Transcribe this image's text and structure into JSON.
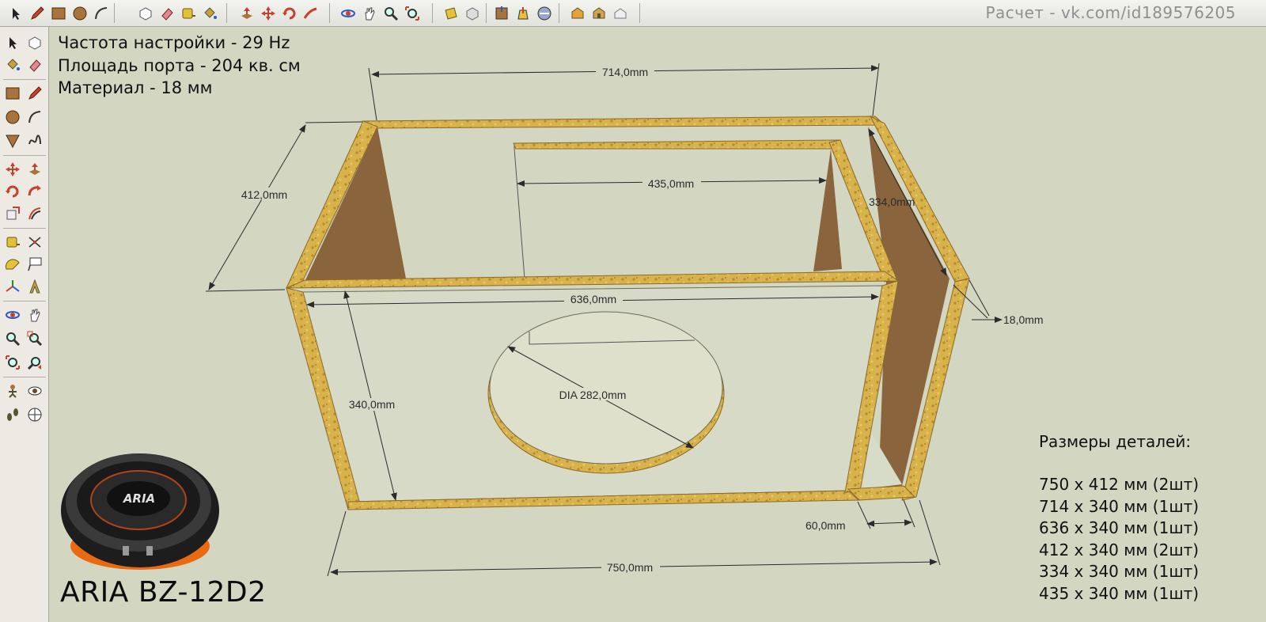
{
  "credit": "Расчет - vk.com/id189576205",
  "info": {
    "tuning": "Частота настройки - 29 Hz",
    "port_area": "Площадь порта - 204 кв. см",
    "material": "Материал - 18 мм"
  },
  "dimensions": {
    "top_width": "714,0mm",
    "depth": "412,0mm",
    "inner_wall": "435,0mm",
    "port_depth": "334,0mm",
    "front_width": "636,0mm",
    "thickness": "18,0mm",
    "height": "340,0mm",
    "cutout": "DIA 282,0mm",
    "port_width": "60,0mm",
    "bottom_width": "750,0mm"
  },
  "parts": {
    "title": "Размеры деталей:",
    "items": [
      "750 x 412 мм (2шт)",
      "714 x 340 мм (1шт)",
      "636 x 340 мм (1шт)",
      "412 x 340 мм (2шт)",
      "334 x 340 мм (1шт)",
      "435 x 340 мм (1шт)"
    ]
  },
  "model": "ARIA BZ-12D2",
  "speaker_logo": "ARIA",
  "icons": {
    "top": [
      "select-icon",
      "pencil-icon",
      "rectangle-icon",
      "circle-icon",
      "arc-icon",
      "make-component-icon",
      "eraser-icon",
      "tape-measure-icon",
      "paint-bucket-icon",
      "push-pull-icon",
      "move-icon",
      "rotate-icon",
      "follow-me-icon",
      "orbit-icon",
      "pan-icon",
      "zoom-icon",
      "zoom-extents-icon",
      "section-plane-icon",
      "view-iso-icon",
      "view-top-icon",
      "view-front-icon",
      "view-right-icon",
      "geo-location-icon",
      "warehouse-icon",
      "share-model-icon",
      "extension-icon"
    ],
    "left": [
      "select-icon",
      "make-component-icon",
      "paint-bucket-icon",
      "eraser-icon",
      "rectangle-icon",
      "pencil-icon",
      "circle-icon",
      "arc-icon",
      "polygon-icon",
      "freehand-icon",
      "move-icon",
      "push-pull-icon",
      "rotate-icon",
      "follow-me-icon",
      "scale-icon",
      "offset-icon",
      "tape-measure-icon",
      "dimension-icon",
      "protractor-icon",
      "text-icon",
      "axes-icon",
      "3d-text-icon",
      "orbit-icon",
      "pan-icon",
      "zoom-icon",
      "zoom-window-icon",
      "zoom-extents-icon",
      "previous-view-icon",
      "position-camera-icon",
      "look-around-icon",
      "walk-icon",
      "section-plane-icon"
    ]
  },
  "colors": {
    "background": "#d3d7c2",
    "wood": "#d8b24a",
    "inner_side": "#8a643c"
  }
}
